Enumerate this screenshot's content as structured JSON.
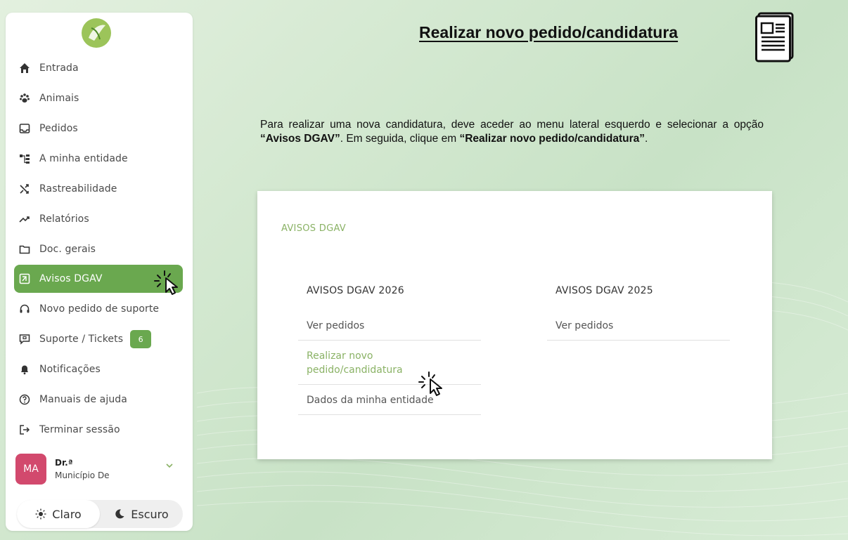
{
  "page": {
    "title": "Realizar novo pedido/candidatura"
  },
  "sidebar": {
    "items": [
      {
        "label": "Entrada",
        "icon": "home-icon"
      },
      {
        "label": "Animais",
        "icon": "paw-icon"
      },
      {
        "label": "Pedidos",
        "icon": "inbox-icon"
      },
      {
        "label": "A minha entidade",
        "icon": "org-chart-icon"
      },
      {
        "label": "Rastreabilidade",
        "icon": "shuffle-icon"
      },
      {
        "label": "Relatórios",
        "icon": "trend-icon"
      },
      {
        "label": "Doc. gerais",
        "icon": "folder-icon"
      },
      {
        "label": "Avisos DGAV",
        "icon": "notice-icon",
        "active": true
      },
      {
        "label": "Novo pedido de suporte",
        "icon": "headset-icon"
      },
      {
        "label": "Suporte / Tickets",
        "icon": "chat-icon",
        "badge": "6"
      },
      {
        "label": "Notificações",
        "icon": "bell-icon"
      },
      {
        "label": "Manuais de ajuda",
        "icon": "help-icon"
      },
      {
        "label": "Terminar sessão",
        "icon": "logout-icon"
      }
    ],
    "user": {
      "initials": "MA",
      "name": "Dr.ª",
      "org": "Município De"
    },
    "theme": {
      "light": "Claro",
      "dark": "Escuro"
    }
  },
  "intro": {
    "part1": "Para realizar uma nova candidatura, deve aceder ao menu lateral esquerdo e selecionar a opção ",
    "bold1": "“Avisos DGAV”",
    "part2": ". Em seguida, clique em ",
    "bold2": "“Realizar novo pedido/candidatura”",
    "part3": "."
  },
  "card": {
    "title": "AVISOS DGAV",
    "columns": [
      {
        "heading": "AVISOS DGAV 2026",
        "links": [
          "Ver pedidos",
          "Realizar novo pedido/candidatura",
          "Dados da minha entidade"
        ]
      },
      {
        "heading": "AVISOS DGAV 2025",
        "links": [
          "Ver pedidos"
        ]
      }
    ]
  },
  "colors": {
    "accent": "#6aa84f",
    "accent_text": "#8ab265",
    "avatar": "#d2496d"
  }
}
